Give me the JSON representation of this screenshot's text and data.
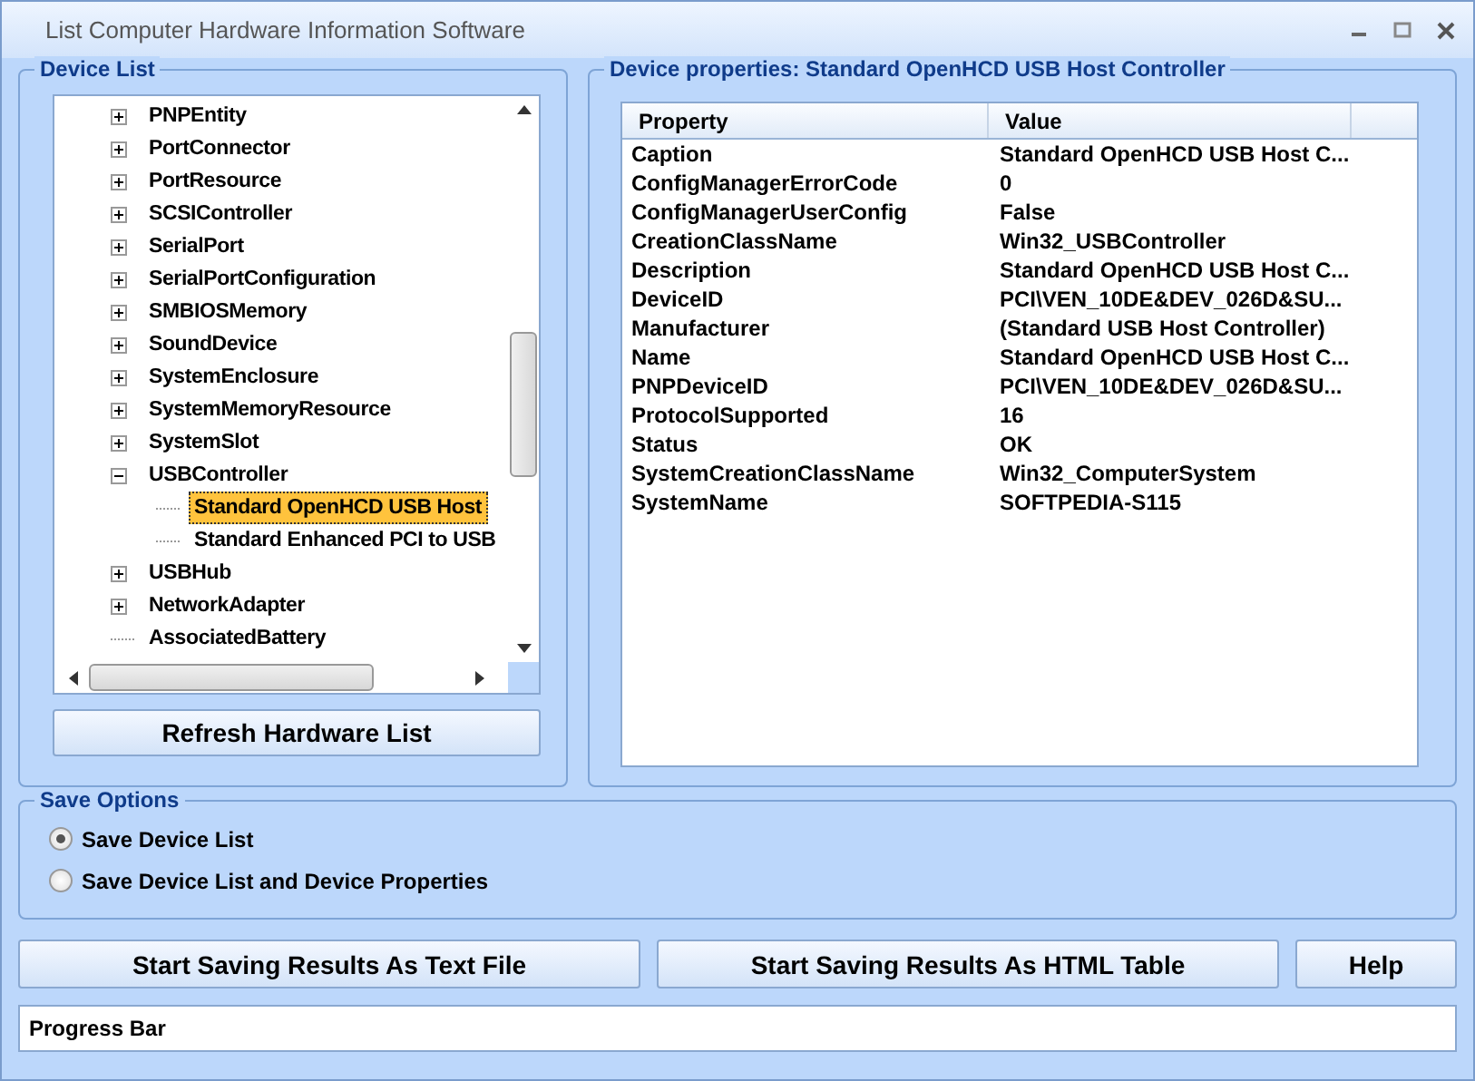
{
  "window": {
    "title": "List Computer Hardware Information Software"
  },
  "device_list": {
    "title": "Device List",
    "tree": [
      {
        "label": "PNPEntity",
        "kind": "group",
        "expanded": false,
        "selected": false
      },
      {
        "label": "PortConnector",
        "kind": "group",
        "expanded": false,
        "selected": false
      },
      {
        "label": "PortResource",
        "kind": "group",
        "expanded": false,
        "selected": false
      },
      {
        "label": "SCSIController",
        "kind": "group",
        "expanded": false,
        "selected": false
      },
      {
        "label": "SerialPort",
        "kind": "group",
        "expanded": false,
        "selected": false
      },
      {
        "label": "SerialPortConfiguration",
        "kind": "group",
        "expanded": false,
        "selected": false
      },
      {
        "label": "SMBIOSMemory",
        "kind": "group",
        "expanded": false,
        "selected": false
      },
      {
        "label": "SoundDevice",
        "kind": "group",
        "expanded": false,
        "selected": false
      },
      {
        "label": "SystemEnclosure",
        "kind": "group",
        "expanded": false,
        "selected": false
      },
      {
        "label": "SystemMemoryResource",
        "kind": "group",
        "expanded": false,
        "selected": false
      },
      {
        "label": "SystemSlot",
        "kind": "group",
        "expanded": false,
        "selected": false
      },
      {
        "label": "USBController",
        "kind": "group",
        "expanded": true,
        "selected": false,
        "children": [
          {
            "label": "Standard OpenHCD USB Host",
            "kind": "leaf",
            "selected": true
          },
          {
            "label": "Standard Enhanced PCI to USB",
            "kind": "leaf",
            "selected": false
          }
        ]
      },
      {
        "label": "USBHub",
        "kind": "group",
        "expanded": false,
        "selected": false
      },
      {
        "label": "NetworkAdapter",
        "kind": "group",
        "expanded": false,
        "selected": false
      },
      {
        "label": "AssociatedBattery",
        "kind": "leaf",
        "selected": false
      }
    ],
    "refresh_button": "Refresh Hardware List"
  },
  "properties": {
    "title": "Device properties: Standard OpenHCD USB Host Controller",
    "columns": [
      "Property",
      "Value"
    ],
    "rows": [
      [
        "Caption",
        "Standard OpenHCD USB Host C..."
      ],
      [
        "ConfigManagerErrorCode",
        "0"
      ],
      [
        "ConfigManagerUserConfig",
        "False"
      ],
      [
        "CreationClassName",
        "Win32_USBController"
      ],
      [
        "Description",
        "Standard OpenHCD USB Host C..."
      ],
      [
        "DeviceID",
        "PCI\\VEN_10DE&DEV_026D&SU..."
      ],
      [
        "Manufacturer",
        "(Standard USB Host Controller)"
      ],
      [
        "Name",
        "Standard OpenHCD USB Host C..."
      ],
      [
        "PNPDeviceID",
        "PCI\\VEN_10DE&DEV_026D&SU..."
      ],
      [
        "ProtocolSupported",
        "16"
      ],
      [
        "Status",
        "OK"
      ],
      [
        "SystemCreationClassName",
        "Win32_ComputerSystem"
      ],
      [
        "SystemName",
        "SOFTPEDIA-S115"
      ]
    ]
  },
  "save_options": {
    "title": "Save Options",
    "options": [
      {
        "label": "Save Device List",
        "selected": true
      },
      {
        "label": "Save Device List and Device Properties",
        "selected": false
      }
    ]
  },
  "buttons": [
    "Start Saving Results As Text File",
    "Start Saving Results As HTML Table",
    "Help"
  ],
  "progress_bar": {
    "label": "Progress Bar"
  }
}
